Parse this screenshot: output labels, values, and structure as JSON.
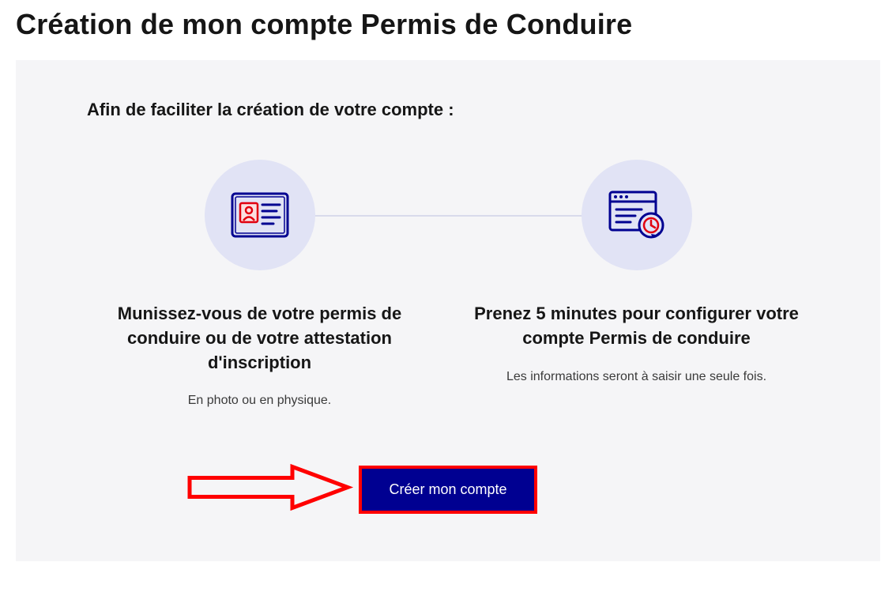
{
  "page_title": "Création de mon compte Permis de Conduire",
  "intro": "Afin de faciliter la création de votre compte :",
  "steps": [
    {
      "title": "Munissez-vous de votre permis de conduire ou de votre attestation d'inscription",
      "desc": "En photo ou en physique."
    },
    {
      "title": "Prenez 5 minutes pour configurer votre compte Permis de conduire",
      "desc": "Les informations seront à saisir une seule fois."
    }
  ],
  "cta_label": "Créer mon compte"
}
